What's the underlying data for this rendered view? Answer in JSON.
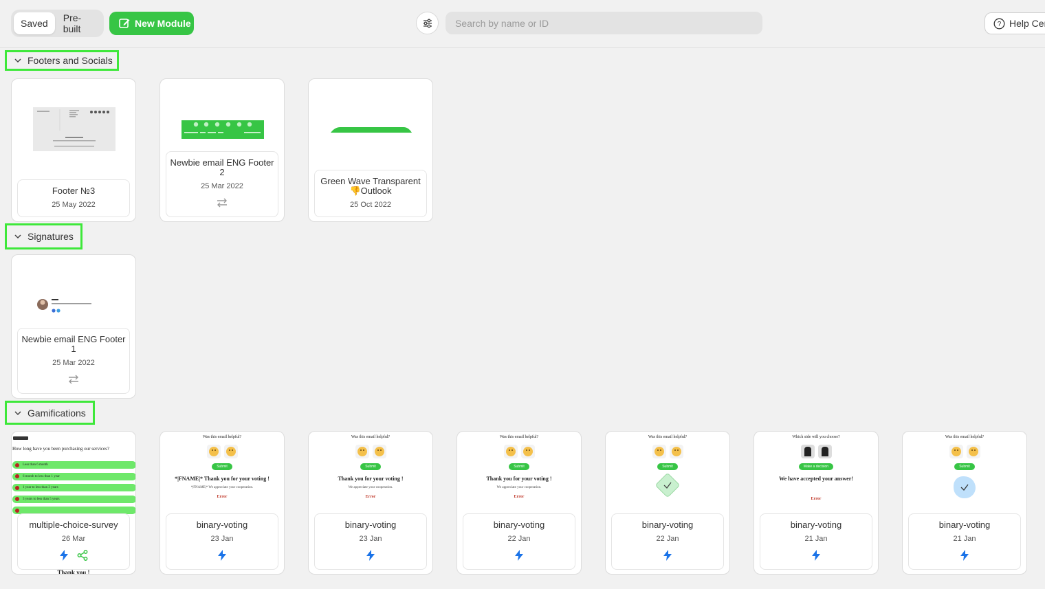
{
  "toolbar": {
    "tabs": [
      "Saved",
      "Pre-built"
    ],
    "new_module_label": "New Module",
    "search_placeholder": "Search by name or ID",
    "help_label": "Help Cen"
  },
  "sections": {
    "footers": {
      "title": "Footers and Socials",
      "cards": [
        {
          "title": "Footer №3",
          "date": "25 May 2022"
        },
        {
          "title": "Newbie email ENG Footer 2",
          "date": "25 Mar 2022"
        },
        {
          "title": "Green Wave Transparent 👎Outlook",
          "date": "25 Oct 2022"
        }
      ]
    },
    "signatures": {
      "title": "Signatures",
      "cards": [
        {
          "title": "Newbie email ENG Footer 1",
          "date": "25 Mar 2022"
        }
      ]
    },
    "gamifications": {
      "title": "Gamifications",
      "cards": [
        {
          "title": "multiple-choice-survey",
          "date": "26 Mar"
        },
        {
          "title": "binary-voting",
          "date": "23 Jan"
        },
        {
          "title": "binary-voting",
          "date": "23 Jan"
        },
        {
          "title": "binary-voting",
          "date": "22 Jan"
        },
        {
          "title": "binary-voting",
          "date": "22 Jan"
        },
        {
          "title": "binary-voting",
          "date": "21 Jan"
        },
        {
          "title": "binary-voting",
          "date": "21 Jan"
        }
      ]
    }
  },
  "previews": {
    "survey": {
      "question": "How long have you been purchasing our services?",
      "options": [
        "Less than 6 month",
        "6 month to less than 1 year",
        "1 year to less than 3 years",
        "3 years to less than 5 years",
        ""
      ],
      "footer": "Thank you !"
    },
    "vote_question": "Was this email helpful?",
    "side_question": "Which side will you choose?",
    "submit": "Submit",
    "make_decision": "Make a decision",
    "thanks_fname": "*|FNAME|* Thank you for your voting !",
    "thanks": "Thank you for your voting !",
    "appreciate_fname": "*|FNAME|* We appreciate your cooperation.",
    "appreciate": "We appreciate your cooperation.",
    "accepted": "We have accepted your answer!",
    "error": "Error"
  },
  "colors": {
    "accent": "#37c545",
    "highlight": "#3ee83a",
    "bolt": "#1a73e8",
    "share": "#37c545"
  }
}
